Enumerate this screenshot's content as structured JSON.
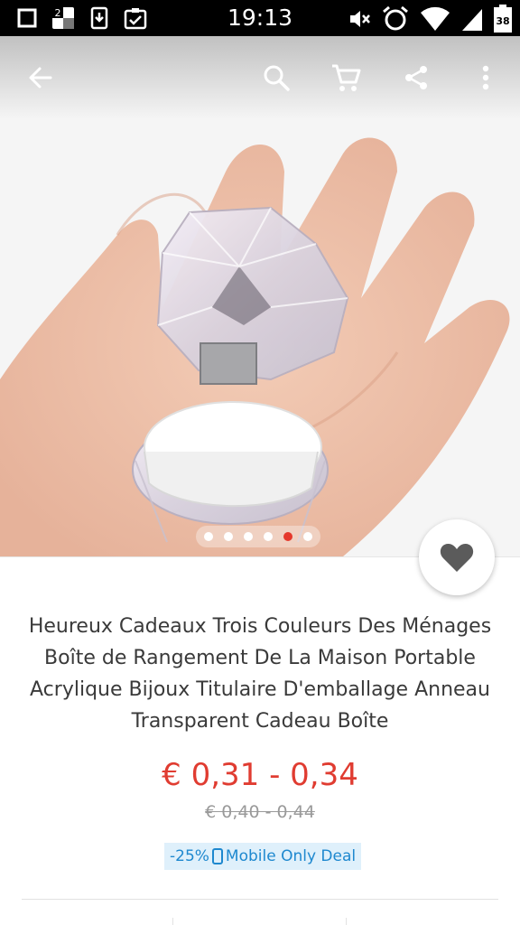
{
  "status_bar": {
    "time": "19:13",
    "notification_badge": "2",
    "battery": "38"
  },
  "toolbar": {
    "back_icon": "arrow-left-icon",
    "search_icon": "search-icon",
    "cart_icon": "cart-icon",
    "share_icon": "share-icon",
    "more_icon": "more-vert-icon"
  },
  "gallery": {
    "image_count": 6,
    "active_index": 4
  },
  "product": {
    "title": "Heureux Cadeaux Trois Couleurs Des Ménages Boîte de Rangement De La Maison Portable Acrylique Bijoux Titulaire D'emballage Anneau Transparent Cadeau Boîte",
    "price_range": "€ 0,31 - 0,34",
    "original_price": "€ 0,40 - 0,44",
    "deal_discount": "-25%",
    "deal_label": "Mobile Only Deal"
  },
  "colors": {
    "price": "#e03c31",
    "deal_text": "#1e88cf",
    "deal_bg": "#dff0fb",
    "active_dot": "#e5382b"
  }
}
